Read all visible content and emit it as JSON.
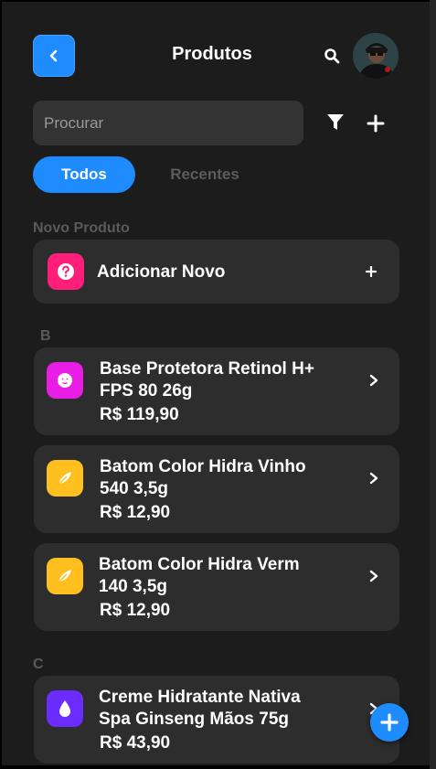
{
  "header": {
    "title": "Produtos",
    "back_icon": "chevron-left-icon",
    "search_icon": "search-icon",
    "avatar": "user-avatar"
  },
  "search": {
    "placeholder": "Procurar",
    "value": "",
    "filter_icon": "filter-icon",
    "add_icon": "plus-icon"
  },
  "tabs": [
    {
      "label": "Todos",
      "active": true
    },
    {
      "label": "Recentes",
      "active": false
    }
  ],
  "new_product": {
    "section_label": "Novo Produto",
    "label": "Adicionar Novo",
    "icon": "question-icon",
    "icon_color": "#ff1f7b",
    "action_icon": "plus-icon"
  },
  "groups": [
    {
      "letter": "B",
      "items": [
        {
          "name_line1": "Base Protetora Retinol H+",
          "name_line2": "FPS 80 26g",
          "price": "R$ 119,90",
          "icon": "face-icon",
          "icon_color": "#e91ee6"
        },
        {
          "name_line1": "Batom Color Hidra Vinho",
          "name_line2": "540 3,5g",
          "price": "R$ 12,90",
          "icon": "feather-icon",
          "icon_color": "#ffbf1f"
        },
        {
          "name_line1": "Batom Color Hidra Verm",
          "name_line2": "140 3,5g",
          "price": "R$ 12,90",
          "icon": "feather-icon",
          "icon_color": "#ffbf1f"
        }
      ]
    },
    {
      "letter": "C",
      "items": [
        {
          "name_line1": "Creme Hidratante Nativa",
          "name_line2": "Spa Ginseng Mãos 75g",
          "price": "R$ 43,90",
          "icon": "drop-icon",
          "icon_color": "#6a2cff"
        }
      ]
    }
  ],
  "fab": {
    "icon": "plus-icon",
    "color": "#1e8cff"
  }
}
